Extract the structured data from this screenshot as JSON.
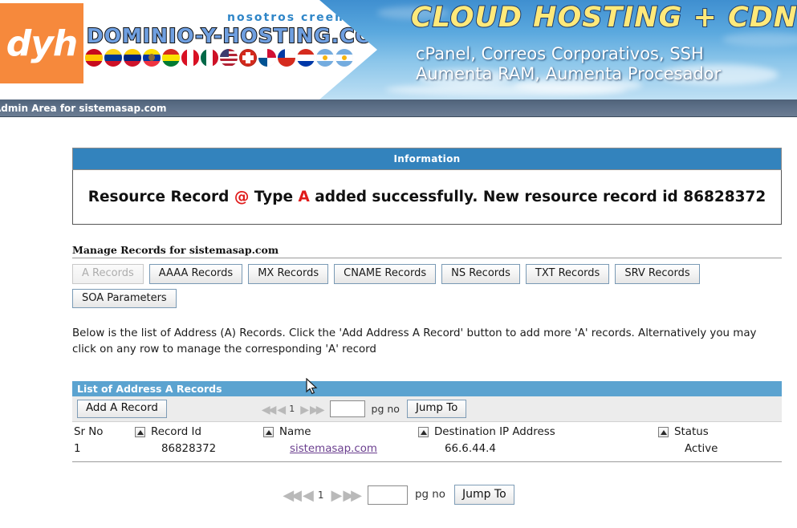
{
  "banner": {
    "logo_text": "dyh",
    "tagline": "nosotros creemos",
    "domain_wordmark": "DOMINIO-Y-HOSTING.COM",
    "headline": "CLOUD HOSTING + CDN",
    "subline1": "cPanel, Correos Corporativos, SSH",
    "subline2": "Aumenta RAM, Aumenta Procesador",
    "colors": {
      "orange": "#f6893c",
      "sky": "#5aa8de",
      "headline_yellow": "#ffe97a"
    },
    "flags": [
      {
        "name": "spain",
        "type": "h3",
        "colors": [
          "#c60b1e",
          "#ffc400",
          "#c60b1e"
        ]
      },
      {
        "name": "colombia",
        "type": "h3",
        "colors": [
          "#fcd116",
          "#003893",
          "#ce1126"
        ]
      },
      {
        "name": "venezuela",
        "type": "h3",
        "colors": [
          "#ffcc00",
          "#00247d",
          "#cf142b"
        ]
      },
      {
        "name": "ecuador",
        "type": "h3",
        "colors": [
          "#ffdd00",
          "#0033a0",
          "#ef3340"
        ]
      },
      {
        "name": "bolivia",
        "type": "h3",
        "colors": [
          "#d52b1e",
          "#f9e300",
          "#007a33"
        ]
      },
      {
        "name": "peru",
        "type": "v3",
        "colors": [
          "#d91023",
          "#ffffff",
          "#d91023"
        ]
      },
      {
        "name": "mexico",
        "type": "v3",
        "colors": [
          "#006847",
          "#ffffff",
          "#ce1126"
        ]
      },
      {
        "name": "united-states",
        "type": "h3",
        "colors": [
          "#3c3b6e",
          "#ffffff",
          "#b22234"
        ]
      },
      {
        "name": "switzerland",
        "type": "h2",
        "colors": [
          "#d52b1e",
          "#d52b1e"
        ]
      },
      {
        "name": "panama",
        "type": "h2",
        "colors": [
          "#005293",
          "#d21034"
        ]
      },
      {
        "name": "chile",
        "type": "h2",
        "colors": [
          "#0039a6",
          "#d52b1e"
        ]
      },
      {
        "name": "paraguay",
        "type": "h3",
        "colors": [
          "#d52b1e",
          "#ffffff",
          "#0038a8"
        ]
      },
      {
        "name": "argentina-sun",
        "type": "h3",
        "colors": [
          "#74acdf",
          "#ffffff",
          "#74acdf"
        ]
      },
      {
        "name": "argentina",
        "type": "h3",
        "colors": [
          "#74acdf",
          "#ffffff",
          "#74acdf"
        ]
      }
    ]
  },
  "adminbar": {
    "text": "Admin Area for sistemasap.com"
  },
  "information": {
    "header": "Information",
    "message_prefix": "Resource Record ",
    "record_name": "@",
    "message_mid": " Type ",
    "record_type": "A",
    "message_suffix": " added successfully. New resource record id 86828372"
  },
  "manage": {
    "title": "Manage Records for sistemasap.com",
    "tabs": [
      {
        "label": "A Records",
        "disabled": true
      },
      {
        "label": "AAAA Records",
        "disabled": false
      },
      {
        "label": "MX Records",
        "disabled": false
      },
      {
        "label": "CNAME Records",
        "disabled": false
      },
      {
        "label": "NS Records",
        "disabled": false
      },
      {
        "label": "TXT Records",
        "disabled": false
      },
      {
        "label": "SRV Records",
        "disabled": false
      },
      {
        "label": "SOA Parameters",
        "disabled": false
      }
    ],
    "description": "Below is the list of Address (A) Records. Click the 'Add Address A Record' button to add more 'A' records. Alternatively you may click on any row to manage the corresponding 'A' record"
  },
  "panel": {
    "header": "List of Address A Records",
    "add_button": "Add A Record",
    "pager": {
      "first": "◀◀",
      "prev": "◀",
      "page": "1",
      "next": "▶",
      "last": "▶▶",
      "input_value": "",
      "label": "pg no",
      "jump_button": "Jump To"
    },
    "columns": [
      {
        "key": "sr_no",
        "label": "Sr No",
        "sortable": false
      },
      {
        "key": "record_id",
        "label": "Record Id",
        "sortable": true
      },
      {
        "key": "name",
        "label": "Name",
        "sortable": true
      },
      {
        "key": "destination_ip",
        "label": "Destination IP Address",
        "sortable": true
      },
      {
        "key": "status",
        "label": "Status",
        "sortable": true
      }
    ],
    "rows": [
      {
        "sr_no": "1",
        "record_id": "86828372",
        "name": "sistemasap.com",
        "destination_ip": "66.6.44.4",
        "status": "Active"
      }
    ]
  },
  "pager_bottom": {
    "first": "◀◀",
    "prev": "◀",
    "page": "1",
    "next": "▶",
    "last": "▶▶",
    "input_value": "",
    "label": "pg no",
    "jump_button": "Jump To"
  }
}
